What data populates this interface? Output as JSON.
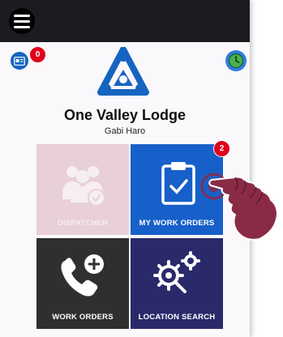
{
  "header": {
    "menu_icon": "hamburger-icon"
  },
  "messages": {
    "icon": "id-card-icon",
    "badge": "0"
  },
  "timeclock": {
    "icon": "clock-icon"
  },
  "organization": {
    "name": "One Valley Lodge",
    "user": "Gabi Haro"
  },
  "tiles": [
    {
      "label": "DISPATCHER",
      "icon": "people-check-icon",
      "color": "#e8cfd8"
    },
    {
      "label": "MY WORK ORDERS",
      "icon": "clipboard-check-icon",
      "color": "#1760c9",
      "badge": "2"
    },
    {
      "label": "WORK ORDERS",
      "icon": "phone-plus-icon",
      "color": "#2f2f2f"
    },
    {
      "label": "LOCATION SEARCH",
      "icon": "gears-search-icon",
      "color": "#2a2a6a"
    }
  ],
  "colors": {
    "topbar": "#1c1b1f",
    "brand": "#1565c0",
    "badge": "#e0001b",
    "pointer": "#8a2b45"
  }
}
